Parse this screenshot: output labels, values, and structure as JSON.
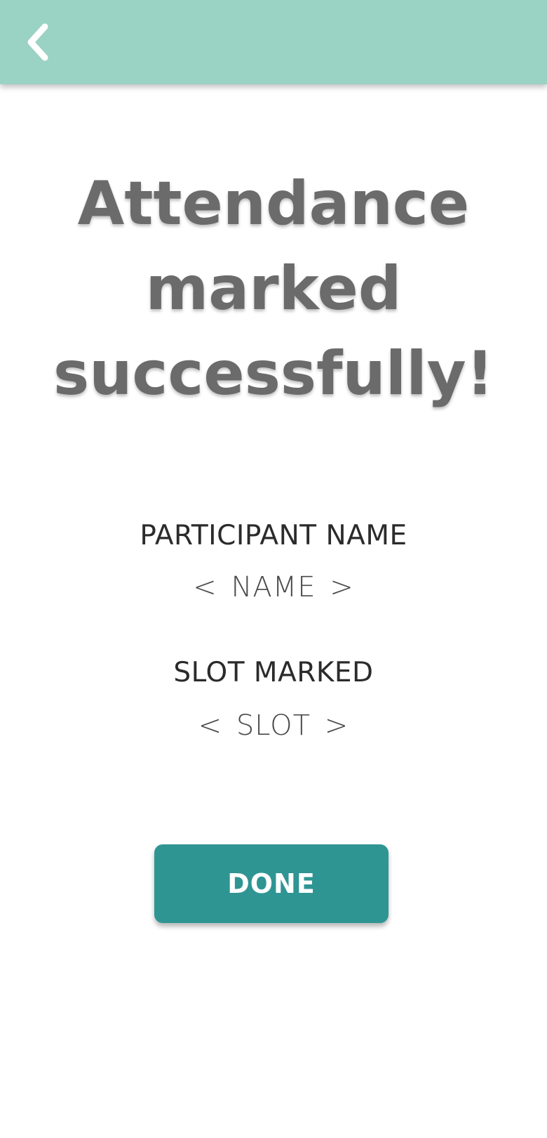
{
  "app_bar": {
    "background_color": "#9ad2c4",
    "back_icon": "chevron-left-icon"
  },
  "headline": {
    "line1": "Attendance",
    "line2": "marked",
    "line3": "successfully!"
  },
  "participant": {
    "label": "PARTICIPANT NAME",
    "value": "< NAME >"
  },
  "slot": {
    "label": "SLOT MARKED",
    "value": "< SLOT >"
  },
  "actions": {
    "done_label": "DONE",
    "done_color": "#2f9593"
  },
  "colors": {
    "headline_text": "#6b6b6b",
    "label_text": "#2b2b2b",
    "value_text": "#4a4a4a"
  }
}
